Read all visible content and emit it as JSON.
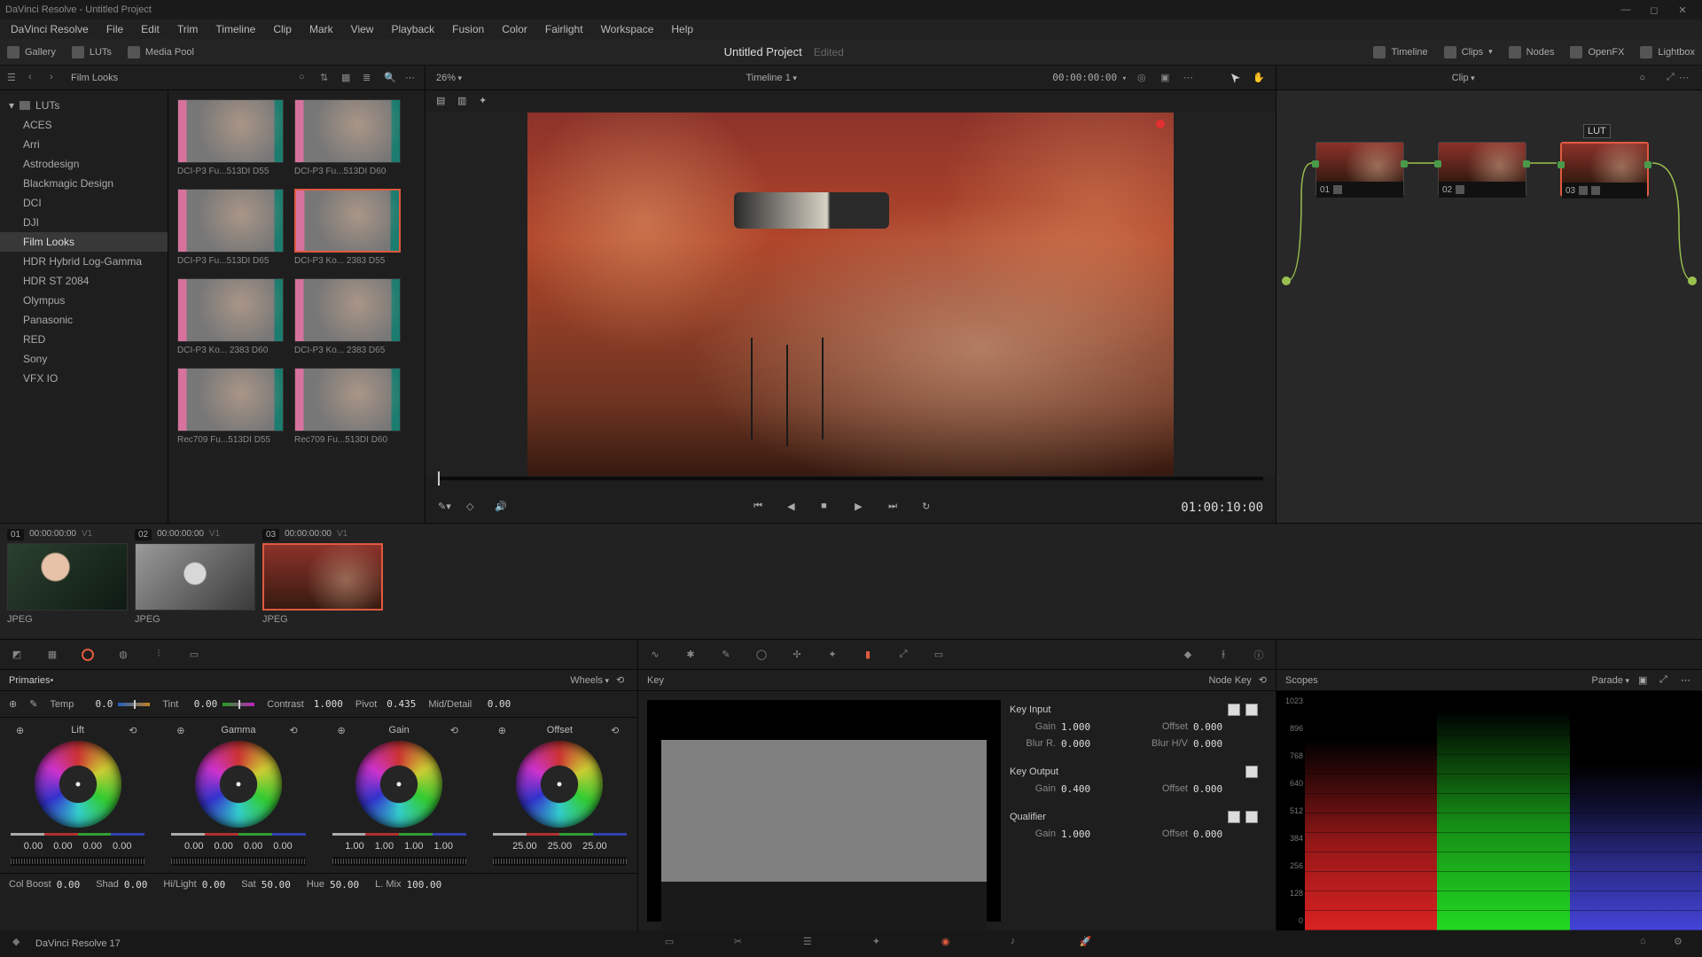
{
  "window": {
    "title": "DaVinci Resolve - Untitled Project"
  },
  "menu": [
    "DaVinci Resolve",
    "File",
    "Edit",
    "Trim",
    "Timeline",
    "Clip",
    "Mark",
    "View",
    "Playback",
    "Fusion",
    "Color",
    "Fairlight",
    "Workspace",
    "Help"
  ],
  "toptool": {
    "gallery": "Gallery",
    "luts": "LUTs",
    "mediapool": "Media Pool",
    "project": "Untitled Project",
    "edited": "Edited",
    "timeline": "Timeline",
    "clips": "Clips",
    "nodes": "Nodes",
    "openfx": "OpenFX",
    "lightbox": "Lightbox"
  },
  "luts_panel": {
    "title": "Film Looks",
    "root": "LUTs",
    "tree": [
      "ACES",
      "Arri",
      "Astrodesign",
      "Blackmagic Design",
      "DCI",
      "DJI",
      "Film Looks",
      "HDR Hybrid Log-Gamma",
      "HDR ST 2084",
      "Olympus",
      "Panasonic",
      "RED",
      "Sony",
      "VFX IO"
    ],
    "selected": "Film Looks",
    "thumbs": [
      {
        "label": "DCI-P3 Fu...513DI D55"
      },
      {
        "label": "DCI-P3 Fu...513DI D60"
      },
      {
        "label": "DCI-P3 Fu...513DI D65"
      },
      {
        "label": "DCI-P3 Ko... 2383 D55",
        "selected": true
      },
      {
        "label": "DCI-P3 Ko... 2383 D60"
      },
      {
        "label": "DCI-P3 Ko... 2383 D65"
      },
      {
        "label": "Rec709 Fu...513DI D55"
      },
      {
        "label": "Rec709 Fu...513DI D60"
      }
    ]
  },
  "viewer": {
    "zoom": "26%",
    "timeline_name": "Timeline 1",
    "src_tc": "00:00:00:00",
    "rec_tc": "01:00:10:00"
  },
  "nodes": {
    "mode": "Clip",
    "label": "LUT",
    "items": [
      {
        "id": "01"
      },
      {
        "id": "02"
      },
      {
        "id": "03",
        "selected": true
      }
    ]
  },
  "clips": [
    {
      "num": "01",
      "tc": "00:00:00:00",
      "trk": "V1",
      "fmt": "JPEG"
    },
    {
      "num": "02",
      "tc": "00:00:00:00",
      "trk": "V1",
      "fmt": "JPEG"
    },
    {
      "num": "03",
      "tc": "00:00:00:00",
      "trk": "V1",
      "fmt": "JPEG",
      "selected": true
    }
  ],
  "primaries": {
    "title": "Primaries",
    "mode": "Wheels",
    "temp_label": "Temp",
    "temp": "0.0",
    "tint_label": "Tint",
    "tint": "0.00",
    "contrast_label": "Contrast",
    "contrast": "1.000",
    "pivot_label": "Pivot",
    "pivot": "0.435",
    "middetail_label": "Mid/Detail",
    "middetail": "0.00",
    "wheels": [
      {
        "name": "Lift",
        "vals": [
          "0.00",
          "0.00",
          "0.00",
          "0.00"
        ]
      },
      {
        "name": "Gamma",
        "vals": [
          "0.00",
          "0.00",
          "0.00",
          "0.00"
        ]
      },
      {
        "name": "Gain",
        "vals": [
          "1.00",
          "1.00",
          "1.00",
          "1.00"
        ]
      },
      {
        "name": "Offset",
        "vals": [
          "25.00",
          "25.00",
          "25.00"
        ]
      }
    ],
    "foot": {
      "colboost_label": "Col Boost",
      "colboost": "0.00",
      "shad_label": "Shad",
      "shad": "0.00",
      "hilight_label": "Hi/Light",
      "hilight": "0.00",
      "sat_label": "Sat",
      "sat": "50.00",
      "hue_label": "Hue",
      "hue": "50.00",
      "lmix_label": "L. Mix",
      "lmix": "100.00"
    }
  },
  "key": {
    "title": "Key",
    "nodekey": "Node Key",
    "input_title": "Key Input",
    "output_title": "Key Output",
    "qualifier_title": "Qualifier",
    "gain_label": "Gain",
    "offset_label": "Offset",
    "blurr_label": "Blur R.",
    "blurhv_label": "Blur H/V",
    "input": {
      "gain": "1.000",
      "offset": "0.000",
      "blurr": "0.000",
      "blurhv": "0.000"
    },
    "output": {
      "gain": "0.400",
      "offset": "0.000"
    },
    "qualifier": {
      "gain": "1.000",
      "offset": "0.000"
    }
  },
  "scopes": {
    "title": "Scopes",
    "mode": "Parade",
    "axis": [
      "1023",
      "896",
      "768",
      "640",
      "512",
      "384",
      "256",
      "128",
      "0"
    ]
  },
  "bottom": {
    "version": "DaVinci Resolve 17"
  }
}
